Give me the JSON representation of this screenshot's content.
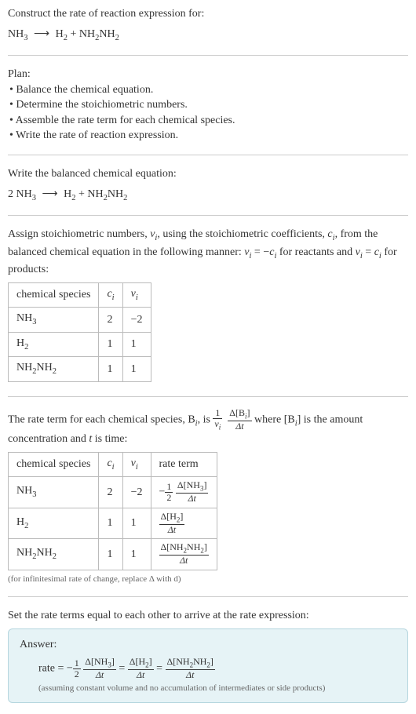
{
  "s1": {
    "prompt": "Construct the rate of reaction expression for:",
    "eq_lhs1": "NH",
    "eq_lhs1_sub": "3",
    "arrow": "⟶",
    "eq_rhs1": "H",
    "eq_rhs1_sub": "2",
    "plus": " + ",
    "eq_rhs2a": "NH",
    "eq_rhs2a_sub": "2",
    "eq_rhs2b": "NH",
    "eq_rhs2b_sub": "2"
  },
  "plan": {
    "title": "Plan:",
    "b1": "• Balance the chemical equation.",
    "b2": "• Determine the stoichiometric numbers.",
    "b3": "• Assemble the rate term for each chemical species.",
    "b4": "• Write the rate of reaction expression."
  },
  "balanced": {
    "prompt": "Write the balanced chemical equation:",
    "coef1": "2 ",
    "lhs1": "NH",
    "lhs1_sub": "3",
    "arrow": "⟶",
    "rhs1": "H",
    "rhs1_sub": "2",
    "plus": " + ",
    "rhs2a": "NH",
    "rhs2a_sub": "2",
    "rhs2b": "NH",
    "rhs2b_sub": "2"
  },
  "assign": {
    "t1": "Assign stoichiometric numbers, ",
    "nu": "ν",
    "nu_sub": "i",
    "t2": ", using the stoichiometric coefficients, ",
    "c": "c",
    "c_sub": "i",
    "t3": ", from the balanced chemical equation in the following manner: ",
    "rel1a": "ν",
    "rel1a_sub": "i",
    "rel1eq": " = −",
    "rel1b": "c",
    "rel1b_sub": "i",
    "t4": " for reactants and ",
    "rel2a": "ν",
    "rel2a_sub": "i",
    "rel2eq": " = ",
    "rel2b": "c",
    "rel2b_sub": "i",
    "t5": " for products:"
  },
  "table1": {
    "h1": "chemical species",
    "h2": "c",
    "h2_sub": "i",
    "h3": "ν",
    "h3_sub": "i",
    "r1": {
      "s1": "NH",
      "s1_sub": "3",
      "c": "2",
      "v": "−2"
    },
    "r2": {
      "s1": "H",
      "s1_sub": "2",
      "c": "1",
      "v": "1"
    },
    "r3": {
      "s1a": "NH",
      "s1a_sub": "2",
      "s1b": "NH",
      "s1b_sub": "2",
      "c": "1",
      "v": "1"
    }
  },
  "rateterm": {
    "t1": "The rate term for each chemical species, B",
    "b_sub": "i",
    "t2": ", is ",
    "f1_num": "1",
    "f1_den_a": "ν",
    "f1_den_sub": "i",
    "f2_num": "Δ[B",
    "f2_num_sub": "i",
    "f2_num_close": "]",
    "f2_den": "Δt",
    "t3": " where [B",
    "t3_sub": "i",
    "t4": "] is the amount concentration and ",
    "t": "t",
    "t5": " is time:"
  },
  "table2": {
    "h1": "chemical species",
    "h2": "c",
    "h2_sub": "i",
    "h3": "ν",
    "h3_sub": "i",
    "h4": "rate term",
    "r1": {
      "s1": "NH",
      "s1_sub": "3",
      "c": "2",
      "v": "−2",
      "neg": "−",
      "fa_num": "1",
      "fa_den": "2",
      "fb_num": "Δ[NH",
      "fb_num_sub": "3",
      "fb_num_close": "]",
      "fb_den": "Δt"
    },
    "r2": {
      "s1": "H",
      "s1_sub": "2",
      "c": "1",
      "v": "1",
      "fb_num": "Δ[H",
      "fb_num_sub": "2",
      "fb_num_close": "]",
      "fb_den": "Δt"
    },
    "r3": {
      "s1a": "NH",
      "s1a_sub": "2",
      "s1b": "NH",
      "s1b_sub": "2",
      "c": "1",
      "v": "1",
      "fb_num": "Δ[NH",
      "fb_num_sub1": "2",
      "fb_num_mid": "NH",
      "fb_num_sub2": "2",
      "fb_num_close": "]",
      "fb_den": "Δt"
    },
    "note": "(for infinitesimal rate of change, replace Δ with d)"
  },
  "final": {
    "intro": "Set the rate terms equal to each other to arrive at the rate expression:"
  },
  "answer": {
    "label": "Answer:",
    "rate": "rate = ",
    "neg": "−",
    "fa_num": "1",
    "fa_den": "2",
    "fb_num": "Δ[NH",
    "fb_num_sub": "3",
    "fb_num_close": "]",
    "fb_den": "Δt",
    "eq": " = ",
    "fc_num": "Δ[H",
    "fc_num_sub": "2",
    "fc_num_close": "]",
    "fc_den": "Δt",
    "fd_num": "Δ[NH",
    "fd_num_sub1": "2",
    "fd_num_mid": "NH",
    "fd_num_sub2": "2",
    "fd_num_close": "]",
    "fd_den": "Δt",
    "note": "(assuming constant volume and no accumulation of intermediates or side products)"
  }
}
